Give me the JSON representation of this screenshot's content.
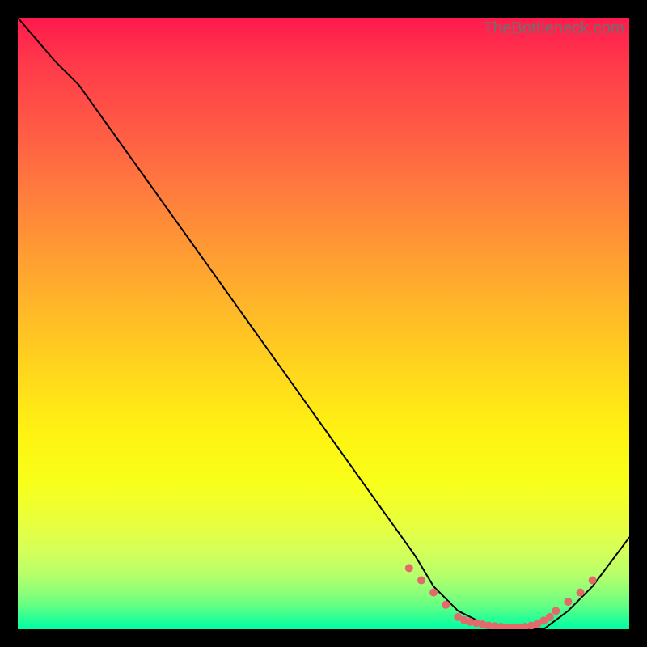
{
  "watermark": "TheBottleneck.com",
  "chart_data": {
    "type": "line",
    "title": "",
    "xlabel": "",
    "ylabel": "",
    "xlim": [
      0,
      100
    ],
    "ylim": [
      0,
      100
    ],
    "grid": false,
    "legend": false,
    "series": [
      {
        "name": "curve",
        "x": [
          0,
          6,
          10,
          20,
          30,
          40,
          50,
          60,
          65,
          68,
          72,
          76,
          82,
          86,
          90,
          94,
          100
        ],
        "y": [
          100,
          93,
          89,
          75,
          61,
          47,
          33,
          19,
          12,
          7,
          3,
          1,
          0,
          0,
          3,
          7,
          15
        ],
        "color": "#000000",
        "weight": 2
      }
    ],
    "markers": {
      "name": "flat-region-dots",
      "color": "#e26a6a",
      "radius": 5,
      "x": [
        64,
        66,
        68,
        70,
        72,
        73,
        74,
        75,
        76,
        77,
        78,
        79,
        80,
        81,
        82,
        83,
        84,
        85,
        86,
        87,
        88,
        90,
        92,
        94
      ],
      "y": [
        10,
        8,
        6,
        4,
        2,
        1.5,
        1.2,
        1.0,
        0.8,
        0.6,
        0.5,
        0.4,
        0.3,
        0.3,
        0.3,
        0.4,
        0.6,
        0.9,
        1.4,
        2.0,
        3.0,
        4.5,
        6.0,
        8.0
      ]
    },
    "background_gradient": {
      "top": "#ff1a4d",
      "mid_upper": "#ff9a33",
      "mid": "#fff312",
      "mid_lower": "#d6ff58",
      "bottom": "#00ffa2"
    }
  }
}
